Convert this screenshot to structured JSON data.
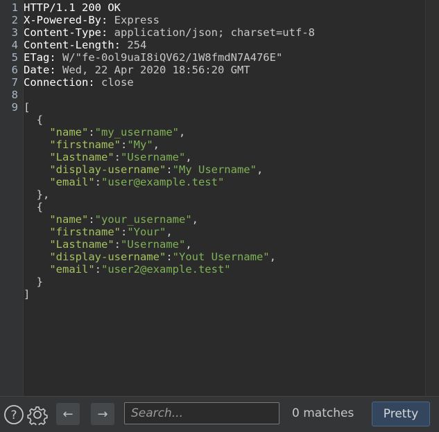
{
  "response": {
    "lines": [
      {
        "n": "1",
        "name": "HTTP/1.1 200 OK",
        "val": ""
      },
      {
        "n": "2",
        "name": "X-Powered-By:",
        "val": " Express"
      },
      {
        "n": "3",
        "name": "Content-Type:",
        "val": " application/json; charset=utf-8"
      },
      {
        "n": "4",
        "name": "Content-Length:",
        "val": " 254"
      },
      {
        "n": "5",
        "name": "ETag:",
        "val": " W/\"fe-0ol9uaI8iQV62/1W8fmdN7A476E\""
      },
      {
        "n": "6",
        "name": "Date:",
        "val": " Wed, 22 Apr 2020 18:56:20 GMT"
      },
      {
        "n": "7",
        "name": "Connection:",
        "val": " close"
      },
      {
        "n": "8",
        "name": "",
        "val": ""
      },
      {
        "n": "9",
        "name": "[",
        "val": ""
      }
    ],
    "body": [
      {
        "text": "  {"
      },
      {
        "key": "\"name\"",
        "value": "\"my_username\"",
        "trail": ","
      },
      {
        "key": "\"firstname\"",
        "value": "\"My\"",
        "trail": ","
      },
      {
        "key": "\"Lastname\"",
        "value": "\"Username\"",
        "trail": ","
      },
      {
        "key": "\"display-username\"",
        "value": "\"My Username\"",
        "trail": ","
      },
      {
        "key": "\"email\"",
        "value": "\"user@example.test\"",
        "trail": ""
      },
      {
        "text": "  },"
      },
      {
        "text": "  {"
      },
      {
        "key": "\"name\"",
        "value": "\"your_username\"",
        "trail": ","
      },
      {
        "key": "\"firstname\"",
        "value": "\"Your\"",
        "trail": ","
      },
      {
        "key": "\"Lastname\"",
        "value": "\"Username\"",
        "trail": ","
      },
      {
        "key": "\"display-username\"",
        "value": "\"Yout Username\"",
        "trail": ","
      },
      {
        "key": "\"email\"",
        "value": "\"user2@example.test\"",
        "trail": ""
      },
      {
        "text": "  }"
      },
      {
        "text": "]"
      }
    ]
  },
  "footer": {
    "help_icon": "question-circle-icon",
    "settings_icon": "gear-icon",
    "back_arrow": "←",
    "forward_arrow": "→",
    "search_placeholder": "Search...",
    "matches_text": "0 matches",
    "pretty_label": "Pretty"
  },
  "colors": {
    "background": "#2b2b2b",
    "json_key": "#a5c261",
    "json_string": "#7fb257",
    "pretty_button": "#33465e"
  }
}
